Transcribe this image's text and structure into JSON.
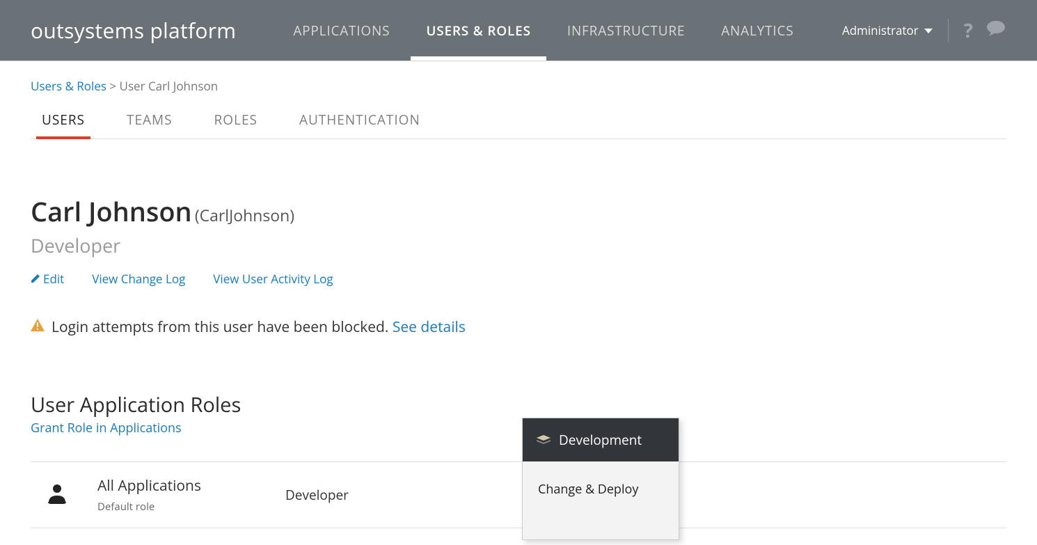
{
  "header": {
    "logo": "outsystems platform",
    "nav": [
      {
        "label": "APPLICATIONS"
      },
      {
        "label": "USERS & ROLES"
      },
      {
        "label": "INFRASTRUCTURE"
      },
      {
        "label": "ANALYTICS"
      }
    ],
    "user_menu": "Administrator"
  },
  "breadcrumb": {
    "link": "Users & Roles",
    "sep": ">",
    "current": "User Carl Johnson"
  },
  "sub_tabs": [
    {
      "label": "USERS"
    },
    {
      "label": "TEAMS"
    },
    {
      "label": "ROLES"
    },
    {
      "label": "AUTHENTICATION"
    }
  ],
  "user": {
    "name": "Carl Johnson",
    "username": "(CarlJohnson)",
    "role": "Developer"
  },
  "actions": {
    "edit": "Edit",
    "change_log": "View Change Log",
    "activity_log": "View User Activity Log"
  },
  "alert": {
    "text": "Login attempts from this user have been blocked.",
    "link": "See details"
  },
  "roles_section": {
    "title": "User Application Roles",
    "grant_link": "Grant Role in Applications"
  },
  "table": {
    "app_name": "All Applications",
    "app_sub": "Default role",
    "role": "Developer"
  },
  "popup": {
    "header": "Development",
    "body": "Change & Deploy"
  }
}
